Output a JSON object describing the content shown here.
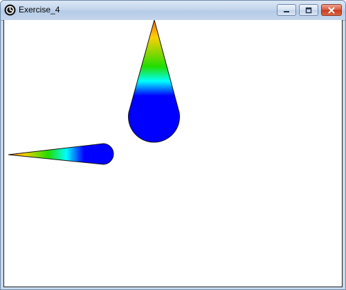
{
  "window": {
    "title": "Exercise_4",
    "controls": {
      "minimize_icon": "minimize-icon",
      "maximize_icon": "maximize-icon",
      "close_icon": "close-icon"
    }
  },
  "canvas": {
    "background": "#ffffff",
    "shapes": [
      {
        "name": "vertical-teardrop",
        "gradient": [
          "#ff6a00",
          "#ffd000",
          "#00cc33",
          "#00ffff",
          "#0000ff"
        ]
      },
      {
        "name": "horizontal-teardrop",
        "gradient": [
          "#ff6a00",
          "#ffd000",
          "#00cc33",
          "#00ffff",
          "#0000ff"
        ]
      }
    ]
  }
}
